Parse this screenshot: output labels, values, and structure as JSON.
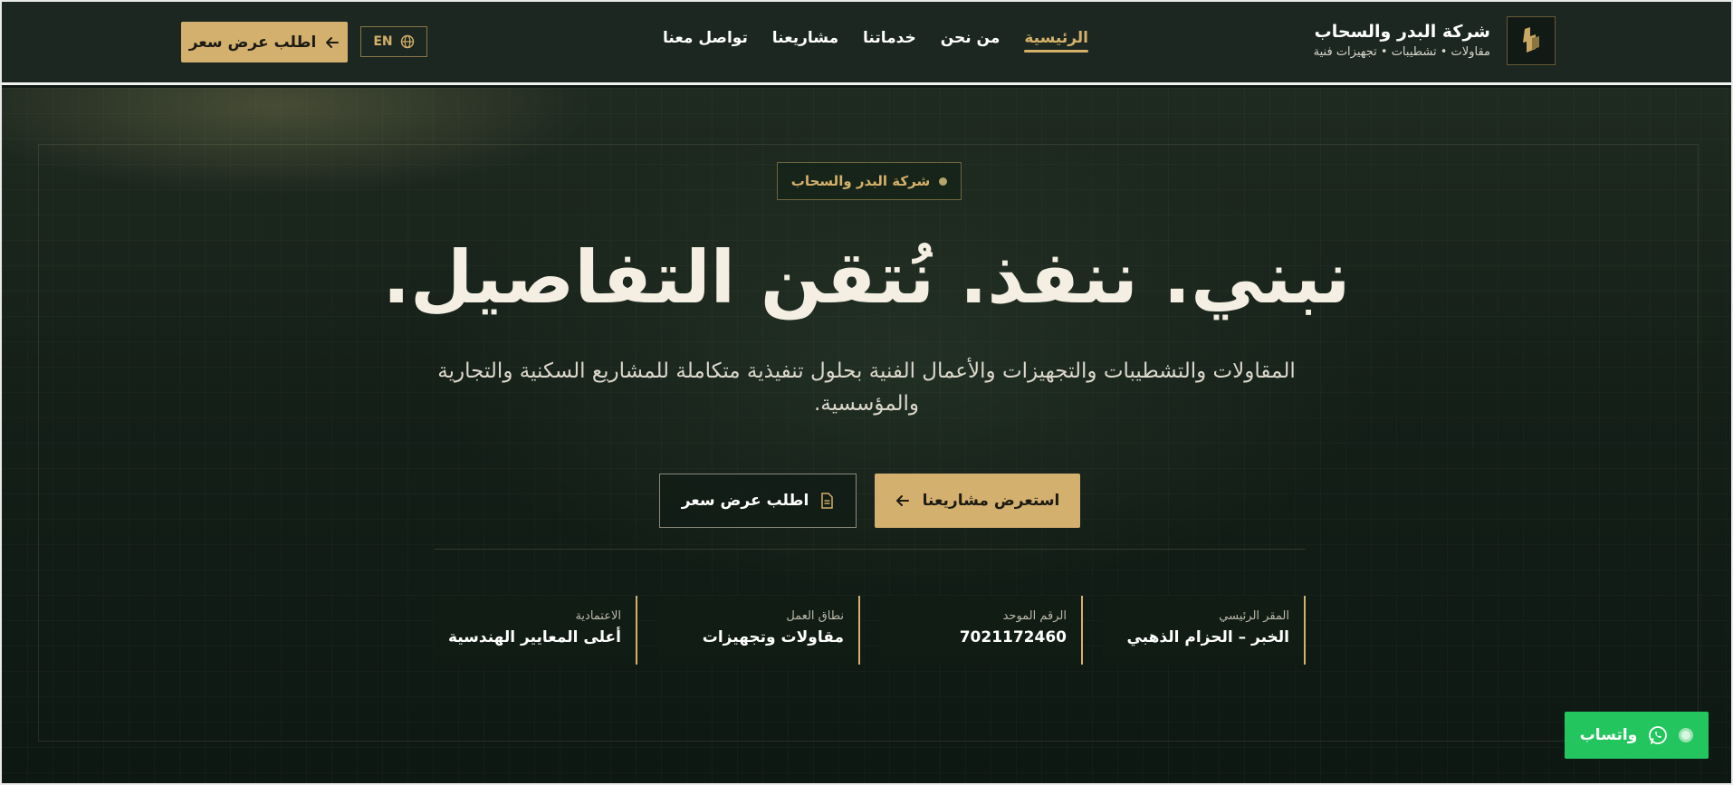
{
  "header": {
    "brand_name": "شركة البدر والسحاب",
    "brand_tagline": "مقاولات • تشطيبات • تجهيزات فنية",
    "logo_icon": "gold-logo-mark",
    "nav": [
      {
        "label": "الرئيسية",
        "active": true
      },
      {
        "label": "من نحن",
        "active": false
      },
      {
        "label": "خدماتنا",
        "active": false
      },
      {
        "label": "مشاريعنا",
        "active": false
      },
      {
        "label": "تواصل معنا",
        "active": false
      }
    ],
    "lang_label": "EN",
    "lang_icon": "globe-icon",
    "quote_button": "اطلب عرض سعر",
    "quote_icon": "arrow-left-icon"
  },
  "hero": {
    "badge": "شركة البدر والسحاب",
    "headline": "نبني. ننفذ. نُتقن التفاصيل.",
    "subline": "المقاولات والتشطيبات والتجهيزات والأعمال الفنية بحلول تنفيذية متكاملة للمشاريع السكنية والتجارية والمؤسسية.",
    "primary_cta": "استعرض مشاريعنا",
    "primary_icon": "arrow-left-icon",
    "secondary_cta": "اطلب عرض سعر",
    "secondary_icon": "document-icon"
  },
  "stats": [
    {
      "label": "المقر الرئيسي",
      "value": "الخبر – الحزام الذهبي"
    },
    {
      "label": "الرقم الموحد",
      "value": "7021172460"
    },
    {
      "label": "نطاق العمل",
      "value": "مقاولات وتجهيزات"
    },
    {
      "label": "الاعتمادية",
      "value": "أعلى المعايير الهندسية"
    }
  ],
  "whatsapp": {
    "label": "واتساب",
    "icon": "whatsapp-icon"
  },
  "colors": {
    "accent": "#d4b06f",
    "header_bg": "#1b2720",
    "whatsapp": "#23c65e"
  }
}
